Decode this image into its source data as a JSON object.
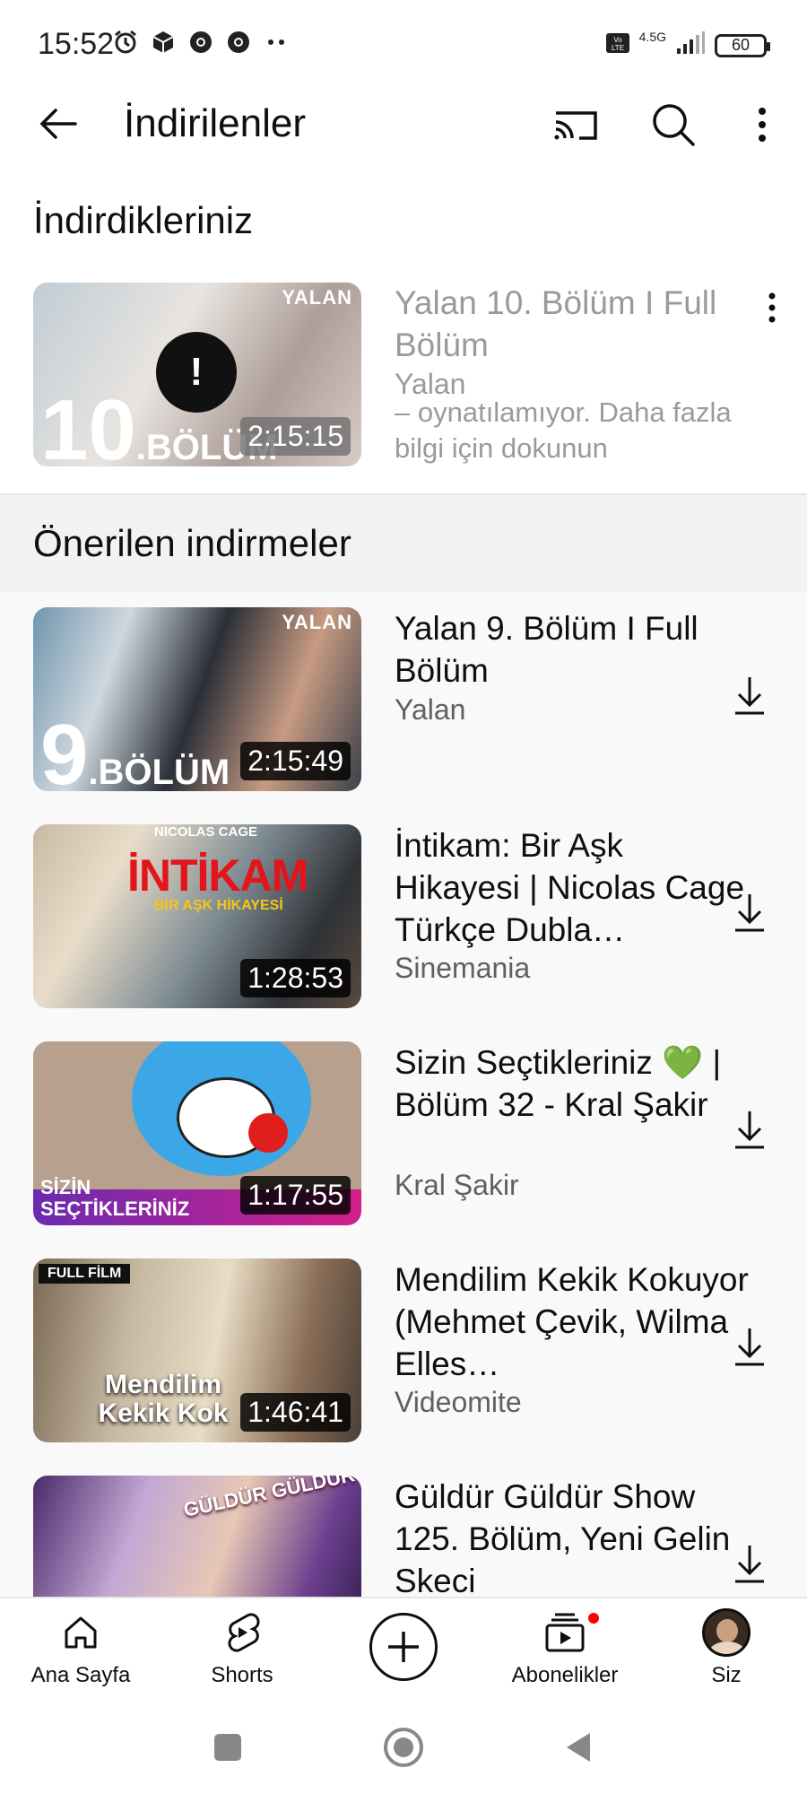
{
  "status_bar": {
    "time": "15:52",
    "network": "4.5G",
    "battery": "60"
  },
  "app_bar": {
    "title": "İndirilenler"
  },
  "downloads_section": {
    "heading": "İndirdikleriniz",
    "items": [
      {
        "title": "Yalan 10. Bölüm I Full Bölüm",
        "channel": "Yalan",
        "status": "– oynatılamıyor. Daha fazla bilgi için dokunun",
        "duration": "2:15:15",
        "thumb_tag": "YALAN",
        "thumb_ep_number": "10",
        "thumb_ep_word": ".BÖLÜM"
      }
    ]
  },
  "suggested_section": {
    "heading": "Önerilen indirmeler",
    "items": [
      {
        "title": "Yalan 9. Bölüm I Full Bölüm",
        "channel": "Yalan",
        "duration": "2:15:49",
        "thumb_tag": "YALAN",
        "thumb_ep_number": "9",
        "thumb_ep_word": ".BÖLÜM"
      },
      {
        "title": "İntikam: Bir Aşk Hikayesi | Nicolas Cage Türkçe Dubla…",
        "channel": "Sinemania",
        "duration": "1:28:53",
        "thumb_tag": "NICOLAS CAGE",
        "thumb_text": "İNTİKAM",
        "thumb_sub": "BİR AŞK HİKAYESİ"
      },
      {
        "title": "Sizin Seçtikleriniz 💚 | Bölüm 32 - Kral Şakir",
        "channel": "Kral Şakir",
        "duration": "1:17:55",
        "thumb_text": "SİZİN SEÇTİKLERİNİZ"
      },
      {
        "title": "Mendilim Kekik Kokuyor (Mehmet Çevik, Wilma Elles…",
        "channel": "Videomite",
        "duration": "1:46:41",
        "thumb_tag": "FULL FİLM",
        "thumb_text": "Mendilim Kekik Kok"
      },
      {
        "title": "Güldür Güldür Show 125. Bölüm, Yeni Gelin Skeci",
        "channel": "",
        "duration": "",
        "thumb_tag": "GÜLDÜR GÜLDÜR"
      }
    ]
  },
  "bottom_nav": {
    "items": [
      {
        "label": "Ana Sayfa",
        "icon": "home-icon"
      },
      {
        "label": "Shorts",
        "icon": "shorts-icon"
      },
      {
        "label": "",
        "icon": "create-icon"
      },
      {
        "label": "Abonelikler",
        "icon": "subscriptions-icon"
      },
      {
        "label": "Siz",
        "icon": "avatar"
      }
    ]
  },
  "colors": {
    "text_primary": "#0f0f0f",
    "text_secondary": "#606060",
    "muted": "#9a9a9a",
    "notification": "#ff0000"
  }
}
